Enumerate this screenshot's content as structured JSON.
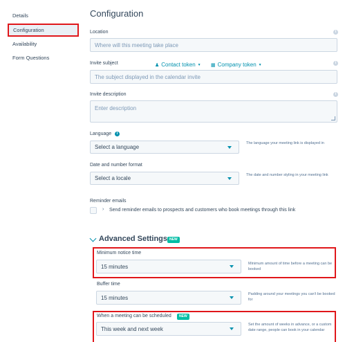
{
  "sidebar": {
    "items": [
      {
        "label": "Details"
      },
      {
        "label": "Configuration"
      },
      {
        "label": "Availability"
      },
      {
        "label": "Form Questions"
      }
    ]
  },
  "page": {
    "title": "Configuration"
  },
  "location": {
    "label": "Location",
    "placeholder": "Where will this meeting take place"
  },
  "invite_subject": {
    "label": "Invite subject",
    "contact_token": "Contact token",
    "company_token": "Company token",
    "placeholder": "The subject displayed in the calendar invite"
  },
  "invite_description": {
    "label": "Invite description",
    "placeholder": "Enter description"
  },
  "language": {
    "label": "Language",
    "value": "Select a language",
    "help": "The language your meeting link is displayed in"
  },
  "date_format": {
    "label": "Date and number format",
    "value": "Select a locale",
    "help": "The date and number styling in your meeting link"
  },
  "reminder": {
    "label": "Reminder emails",
    "text": "Send reminder emails to prospects and customers who book meetings through this link"
  },
  "advanced": {
    "title": "Advanced Settings",
    "badge": "NEW"
  },
  "min_notice": {
    "label": "Minimum notice time",
    "value": "15 minutes",
    "help": "Minimum amount of time before a meeting can be booked"
  },
  "buffer": {
    "label": "Buffer time",
    "value": "15 minutes",
    "help": "Padding around your meetings you can't be booked for"
  },
  "schedule_range": {
    "label": "When a meeting can be scheduled",
    "badge": "NEW",
    "value": "This week and next week",
    "help": "Set the amount of weeks in advance, or a custom date range, people can book in your calendar"
  },
  "colors": {
    "accent": "#0091ae",
    "highlight": "#e0161a",
    "badge": "#00bda5",
    "input_bg": "#f5f8fa",
    "border": "#cbd6e2"
  }
}
